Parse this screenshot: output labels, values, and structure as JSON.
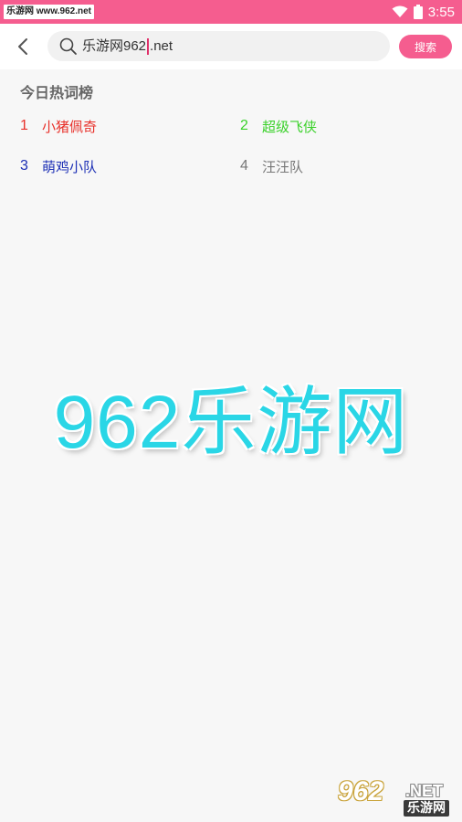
{
  "status_bar": {
    "watermark": "乐游网 www.962.net",
    "time": "3:55",
    "color": "#f55d8f"
  },
  "toolbar": {
    "back_icon": "chevron-left-icon",
    "search": {
      "value_before_caret": "乐游网962",
      "value_after_caret": ".net",
      "icon": "search-icon"
    },
    "search_button": "搜索"
  },
  "hot": {
    "title": "今日热词榜",
    "items": [
      {
        "rank": "1",
        "label": "小猪佩奇",
        "color": "#e8302a"
      },
      {
        "rank": "2",
        "label": "超级飞侠",
        "color": "#3ad12a"
      },
      {
        "rank": "3",
        "label": "萌鸡小队",
        "color": "#1c2fb5"
      },
      {
        "rank": "4",
        "label": "汪汪队",
        "color": "#777777"
      }
    ]
  },
  "overlay": {
    "big_watermark": "962乐游网",
    "corner_logo_num": "962",
    "corner_logo_net": ".NET",
    "corner_logo_cn": "乐游网"
  }
}
